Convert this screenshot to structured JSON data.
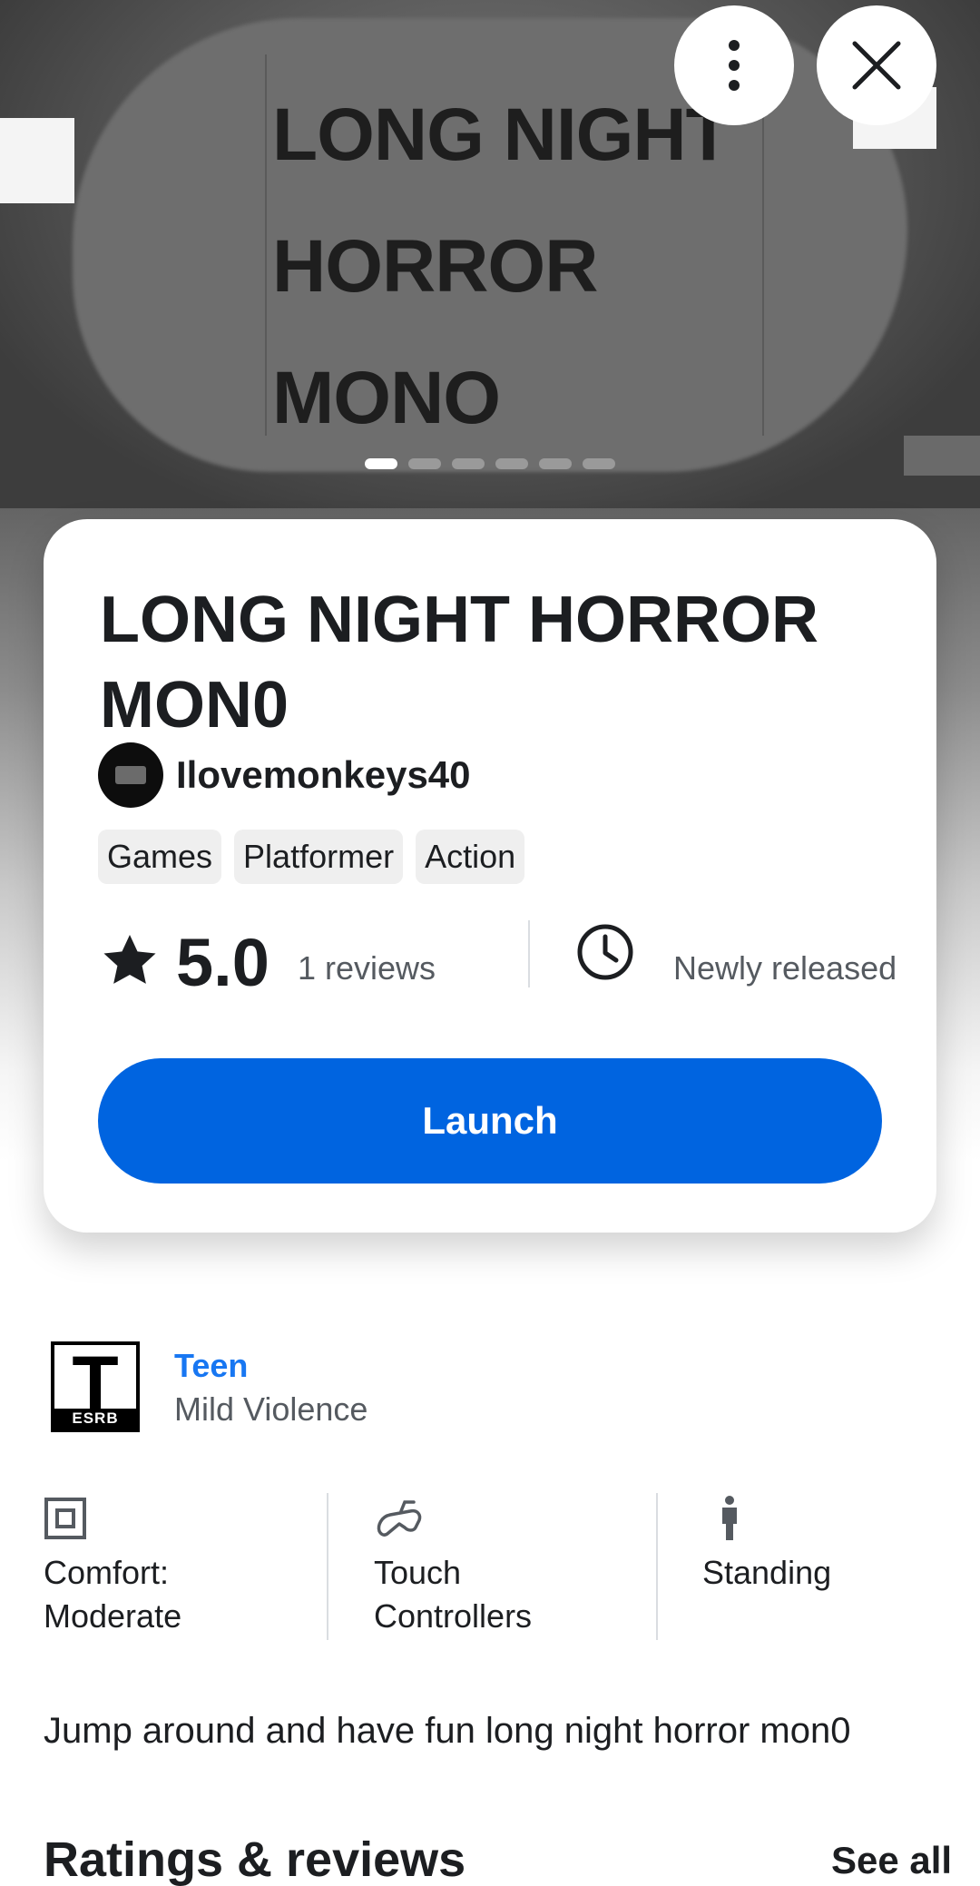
{
  "hero": {
    "lines": [
      "LONG NIGHT",
      "HORROR",
      "MONO"
    ],
    "page_count": 6,
    "active_index": 0
  },
  "game": {
    "title": "LONG NIGHT HORROR MON0",
    "creator": "Ilovemonkeys40",
    "tags": [
      "Games",
      "Platformer",
      "Action"
    ],
    "rating": "5.0",
    "reviews": "1 reviews",
    "release": "Newly released",
    "launch_label": "Launch"
  },
  "esrb": {
    "badge_letter": "T",
    "badge_text": "ESRB",
    "rating": "Teen",
    "descriptor": "Mild Violence"
  },
  "features": [
    {
      "icon": "comfort-icon",
      "line1": "Comfort:",
      "line2": "Moderate"
    },
    {
      "icon": "touch-controller-icon",
      "line1": "Touch",
      "line2": "Controllers"
    },
    {
      "icon": "standing-person-icon",
      "line1": "Standing",
      "line2": ""
    }
  ],
  "description": "Jump around and have fun long night horror mon0",
  "reviews_section": {
    "title": "Ratings & reviews",
    "see_all": "See all"
  },
  "colors": {
    "accent": "#0064e0",
    "link": "#1877f2",
    "text": "#1c1e21",
    "secondary_text": "#555a60"
  }
}
